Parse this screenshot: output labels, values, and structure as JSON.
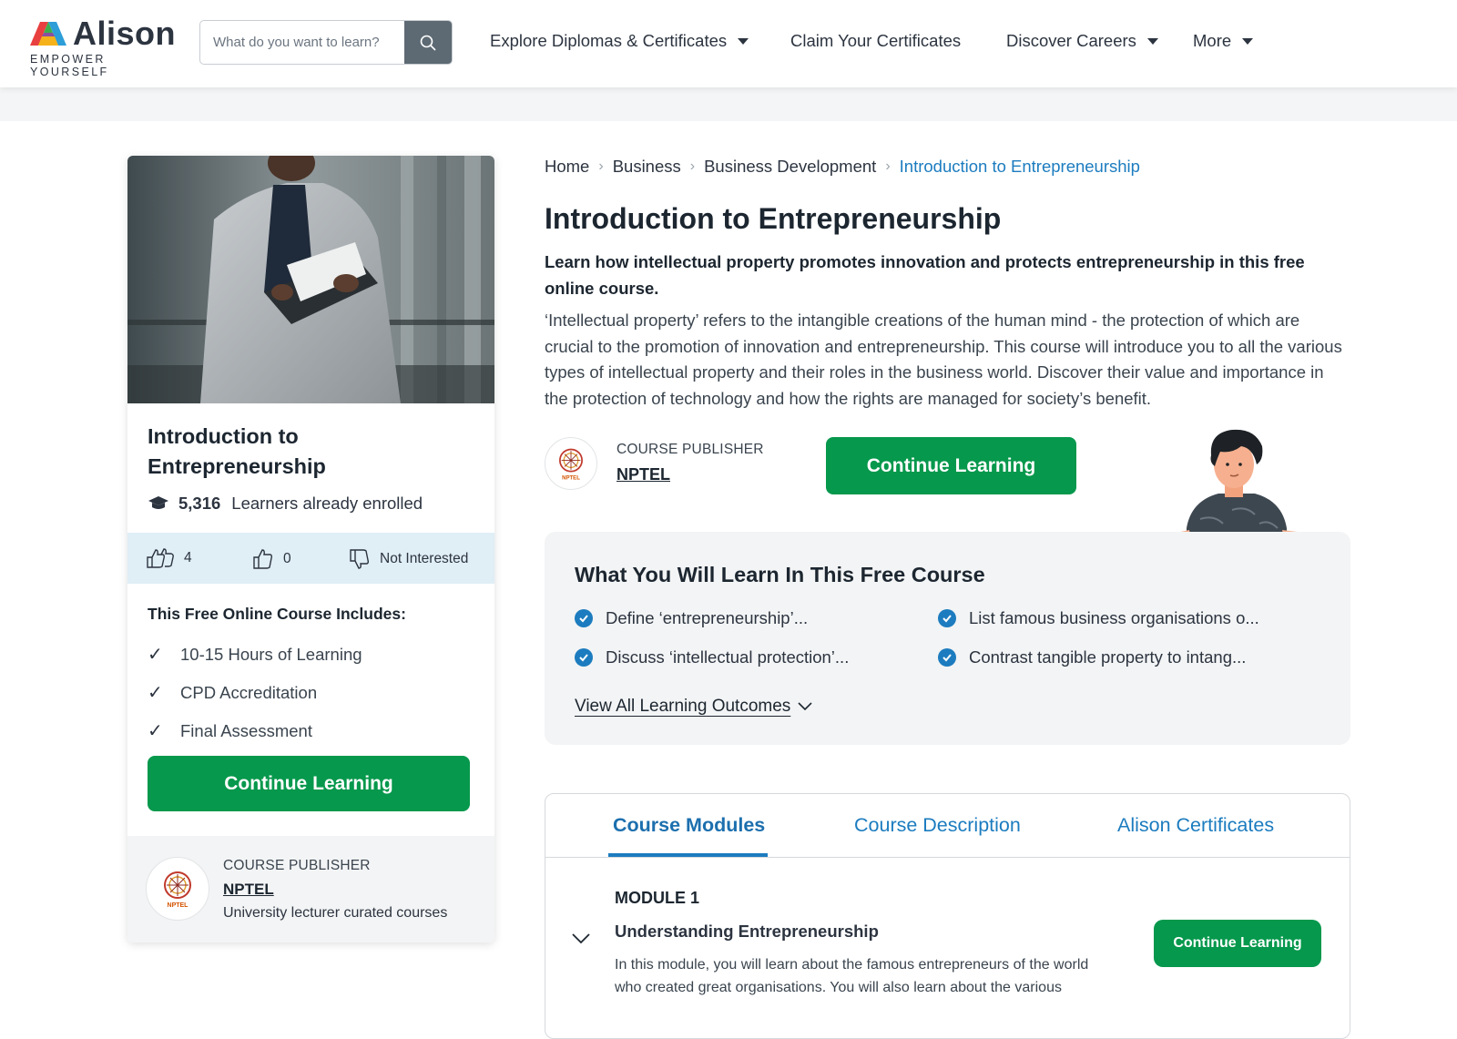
{
  "header": {
    "brand": "Alison",
    "tagline": "EMPOWER YOURSELF",
    "search_placeholder": "What do you want to learn?",
    "nav": [
      {
        "label": "Explore Diplomas & Certificates",
        "dropdown": true
      },
      {
        "label": "Claim Your Certificates",
        "dropdown": false
      },
      {
        "label": "Discover Careers",
        "dropdown": true
      },
      {
        "label": "More",
        "dropdown": true
      }
    ]
  },
  "card": {
    "title": "Introduction to Entrepreneurship",
    "enrolled_count": "5,316",
    "enrolled_text": "Learners already enrolled",
    "likes": "4",
    "thumbs_up": "0",
    "not_interested": "Not Interested",
    "includes_title": "This Free Online Course Includes:",
    "includes": [
      "10-15 Hours of Learning",
      "CPD Accreditation",
      "Final Assessment"
    ],
    "cta": "Continue Learning",
    "publisher_label": "COURSE PUBLISHER",
    "publisher_name": "NPTEL",
    "publisher_desc": "University lecturer curated courses"
  },
  "breadcrumb": [
    "Home",
    "Business",
    "Business Development",
    "Introduction to Entrepreneurship"
  ],
  "main": {
    "title": "Introduction to Entrepreneurship",
    "subtitle": "Learn how intellectual property promotes innovation and protects entrepreneurship in this free online course.",
    "description": "‘Intellectual property’ refers to the intangible creations of the human mind - the protection of which are crucial to the promotion of innovation and entrepreneurship. This course will introduce you to all the various types of intellectual property and their roles in the business world. Discover their value and importance in the protection of technology and how the rights are managed for society’s benefit.",
    "publisher_label": "COURSE PUBLISHER",
    "publisher_name": "NPTEL",
    "cta": "Continue Learning"
  },
  "learn": {
    "title": "What You Will Learn In This Free Course",
    "outcomes": [
      "Define ‘entrepreneurship’...",
      "List famous business organisations o...",
      "Discuss ‘intellectual protection’...",
      "Contrast tangible property to intang..."
    ],
    "view_all": "View All Learning Outcomes"
  },
  "modules": {
    "tabs": [
      "Course  Modules",
      "Course  Description",
      "Alison  Certificates"
    ],
    "active_tab": 0,
    "module_label": "MODULE 1",
    "module_name": "Understanding Entrepreneurship",
    "module_desc": "In this module, you will learn about the famous entrepreneurs of the world who created great organisations. You will also learn about the various",
    "cta": "Continue Learning"
  },
  "colors": {
    "accent_green": "#06984c",
    "link_blue": "#1c7cbf",
    "vote_bar": "#e0eef6"
  }
}
